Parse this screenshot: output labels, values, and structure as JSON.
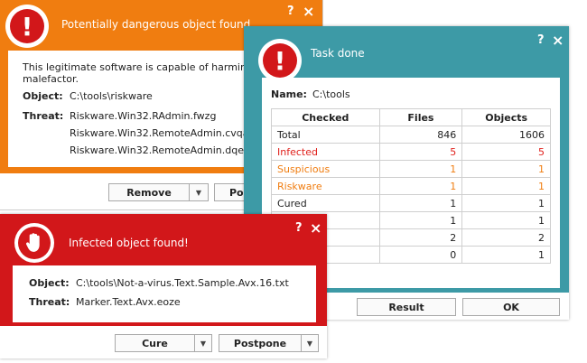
{
  "dangerous_window": {
    "title": "Potentially dangerous object found",
    "help": "?",
    "close": "×",
    "message": "This legitimate software is capable of harming us",
    "message_line2": "malefactor.",
    "object_label": "Object:",
    "object_value": "C:\\tools\\riskware",
    "threat_label": "Threat:",
    "threats": [
      "Riskware.Win32.RAdmin.fwzg",
      "Riskware.Win32.RemoteAdmin.cvqazc",
      "Riskware.Win32.RemoteAdmin.dqeoog"
    ],
    "remove_button": "Remove",
    "postpone_button": "Po",
    "dropdown_glyph": "▼",
    "accent_color": "#f07d10"
  },
  "task_window": {
    "title": "Task done",
    "help": "?",
    "close": "×",
    "name_label": "Name:",
    "name_value": "C:\\tools",
    "columns": [
      "Checked",
      "Files",
      "Objects"
    ],
    "rows": [
      {
        "label": "Total",
        "files": "846",
        "objects": "1606",
        "color": "#222222"
      },
      {
        "label": "Infected",
        "files": "5",
        "objects": "5",
        "color": "#e0201b"
      },
      {
        "label": "Suspicious",
        "files": "1",
        "objects": "1",
        "color": "#f07d10"
      },
      {
        "label": "Riskware",
        "files": "1",
        "objects": "1",
        "color": "#f07d10"
      },
      {
        "label": "Cured",
        "files": "1",
        "objects": "1",
        "color": "#222222"
      },
      {
        "label": "",
        "files": "1",
        "objects": "1",
        "color": "#222222"
      },
      {
        "label": "",
        "files": "2",
        "objects": "2",
        "color": "#222222"
      },
      {
        "label": "",
        "files": "0",
        "objects": "1",
        "color": "#222222"
      }
    ],
    "result_button": "Result",
    "ok_button": "OK",
    "accent_color": "#3d9aa6"
  },
  "infected_window": {
    "title": "Infected object found!",
    "help": "?",
    "close": "×",
    "object_label": "Object:",
    "object_value": "C:\\tools\\Not-a-virus.Text.Sample.Avx.16.txt",
    "threat_label": "Threat:",
    "threat_value": "Marker.Text.Avx.eoze",
    "cure_button": "Cure",
    "postpone_button": "Postpone",
    "dropdown_glyph": "▼",
    "accent_color": "#d2171a"
  }
}
